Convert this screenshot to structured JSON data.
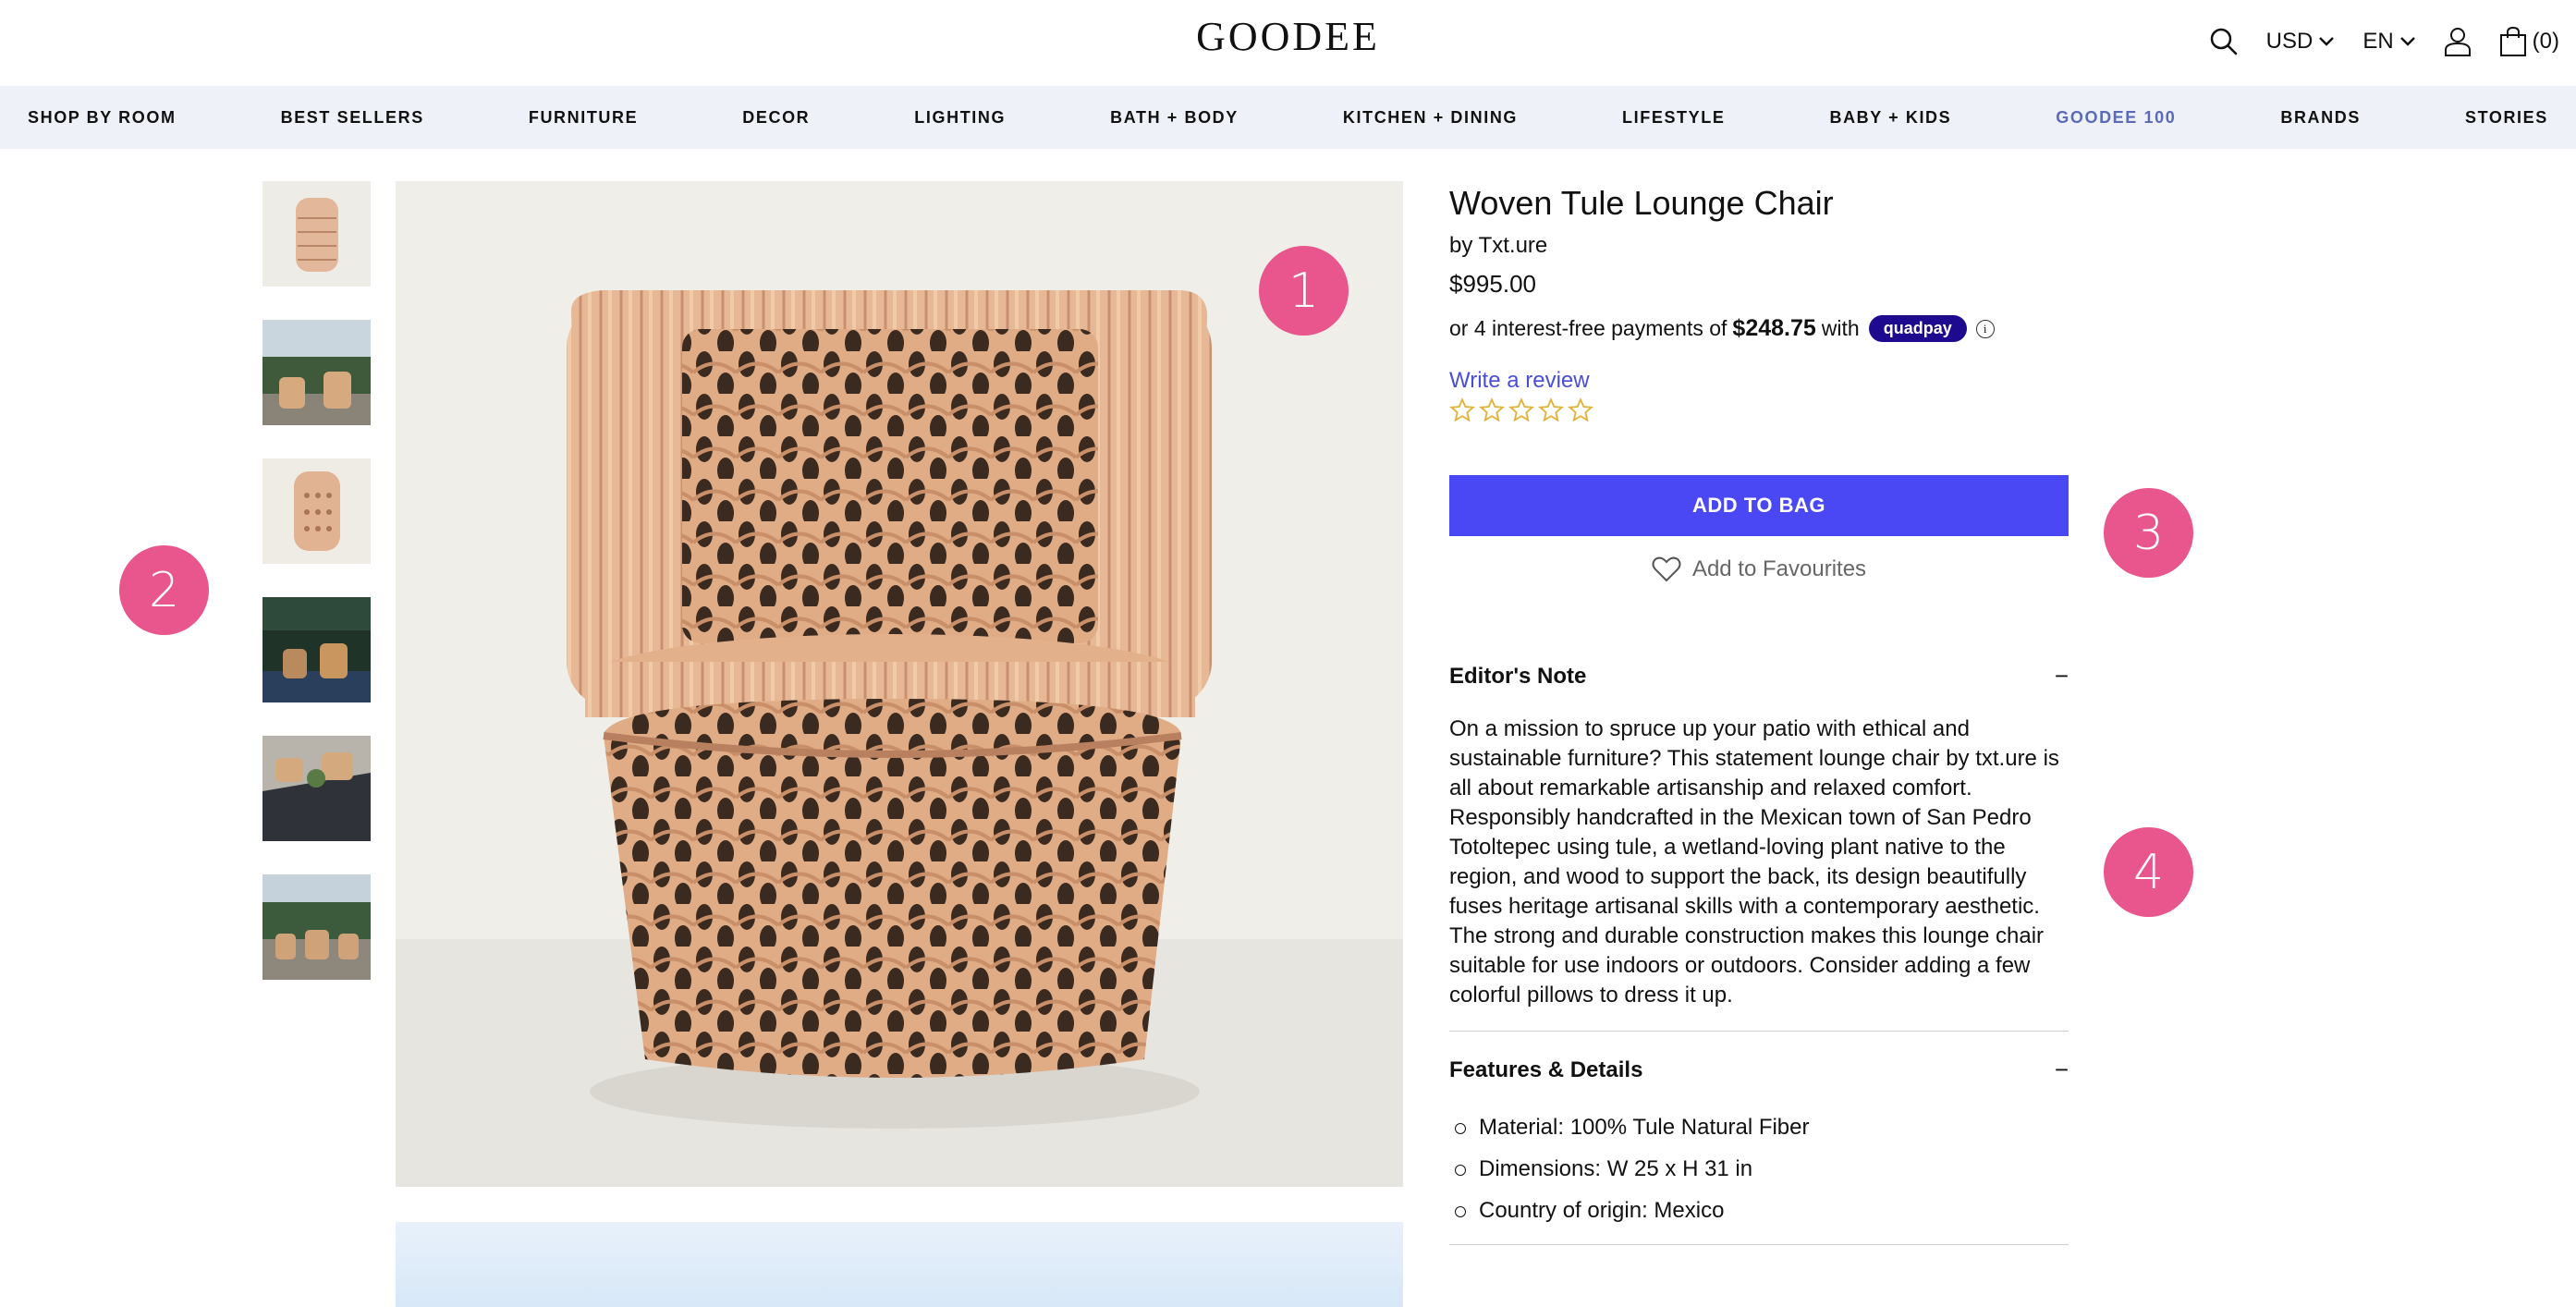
{
  "header": {
    "logo": "GOODEE",
    "currency": "USD",
    "language": "EN",
    "cart_count": "(0)"
  },
  "nav": {
    "items": [
      {
        "label": "SHOP BY ROOM"
      },
      {
        "label": "BEST SELLERS"
      },
      {
        "label": "FURNITURE"
      },
      {
        "label": "DECOR"
      },
      {
        "label": "LIGHTING"
      },
      {
        "label": "BATH + BODY"
      },
      {
        "label": "KITCHEN + DINING"
      },
      {
        "label": "LIFESTYLE"
      },
      {
        "label": "BABY + KIDS"
      },
      {
        "label": "GOODEE 100"
      },
      {
        "label": "BRANDS"
      },
      {
        "label": "STORIES"
      }
    ],
    "accent_color": "#5a6ab8"
  },
  "badges": [
    "1",
    "2",
    "3",
    "4"
  ],
  "product": {
    "title": "Woven Tule Lounge Chair",
    "brand": "by Txt.ure",
    "price": "$995.00",
    "installment_prefix": "or 4 interest-free payments of",
    "installment_amount": "$248.75",
    "installment_with": "with",
    "quadpay_label": "quadpay",
    "info_glyph": "i",
    "review_link": "Write a review",
    "rating": 0,
    "rating_max": 5,
    "add_to_bag": "ADD TO BAG",
    "add_to_favourites": "Add to Favourites",
    "button_color": "#4a47f5"
  },
  "editors_note": {
    "heading": "Editor's Note",
    "toggle": "−",
    "text": "On a mission to spruce up your patio with ethical and sustainable furniture? This statement lounge chair by txt.ure is all about remarkable artisanship and relaxed comfort. Responsibly handcrafted in the Mexican town of San Pedro Totoltepec using tule, a wetland-loving plant native to the region, and wood to support the back, its design beautifully fuses heritage artisanal skills with a contemporary aesthetic. The strong and durable construction makes this lounge chair suitable for use indoors or outdoors. Consider adding a few colorful pillows to dress it up."
  },
  "features": {
    "heading": "Features & Details",
    "toggle": "−",
    "items": [
      "Material: 100% Tule Natural Fiber",
      "Dimensions: W 25 x H 31 in",
      "Country of origin: Mexico"
    ]
  }
}
